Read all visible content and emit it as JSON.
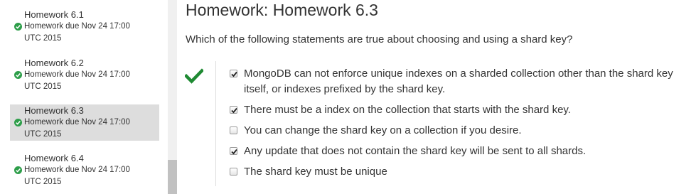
{
  "sidebar": {
    "items": [
      {
        "title": "Homework 6.1",
        "due": "Homework due Nov 24 17:00",
        "tz": "UTC 2015",
        "completed": true,
        "active": false
      },
      {
        "title": "Homework 6.2",
        "due": "Homework due Nov 24 17:00",
        "tz": "UTC 2015",
        "completed": true,
        "active": false
      },
      {
        "title": "Homework 6.3",
        "due": "Homework due Nov 24 17:00",
        "tz": "UTC 2015",
        "completed": true,
        "active": true
      },
      {
        "title": "Homework 6.4",
        "due": "Homework due Nov 24 17:00",
        "tz": "UTC 2015",
        "completed": true,
        "active": false
      }
    ],
    "check_icon": "check-circle-icon",
    "check_color": "#2e9e4a"
  },
  "main": {
    "title": "Homework: Homework 6.3",
    "question": "Which of the following statements are true about choosing and using a shard key?",
    "result_icon": "checkmark-icon",
    "result_color": "#1f8a33",
    "options": [
      {
        "label": "MongoDB can not enforce unique indexes on a sharded collection other than the shard key itself, or indexes prefixed by the shard key.",
        "checked": true
      },
      {
        "label": "There must be a index on the collection that starts with the shard key.",
        "checked": true
      },
      {
        "label": "You can change the shard key on a collection if you desire.",
        "checked": false
      },
      {
        "label": "Any update that does not contain the shard key will be sent to all shards.",
        "checked": true
      },
      {
        "label": "The shard key must be unique",
        "checked": false
      }
    ]
  }
}
